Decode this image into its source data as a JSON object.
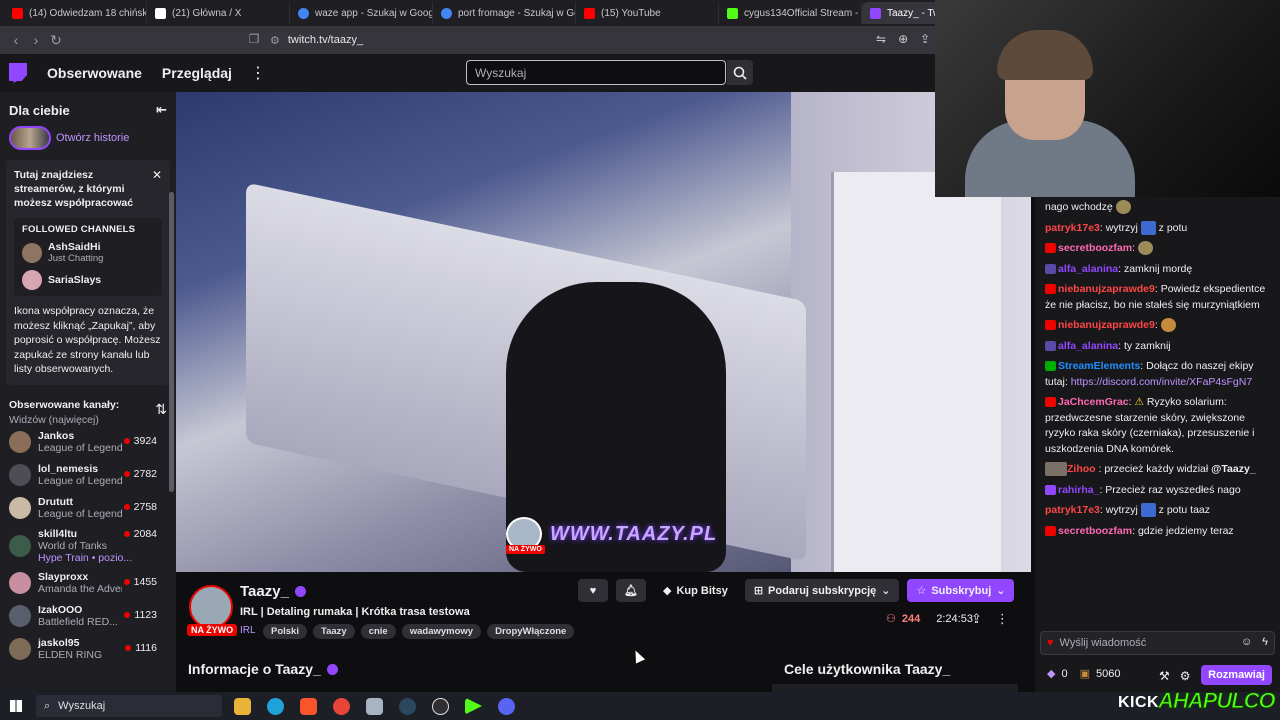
{
  "browser": {
    "tabs": [
      {
        "label": "(14) Odwiedzam 18 chińskich s",
        "color": "#ff0000"
      },
      {
        "label": "(21) Główna / X",
        "color": "#ffffff"
      },
      {
        "label": "waze app - Szukaj w Google",
        "color": "#4285f4"
      },
      {
        "label": "port fromage - Szukaj w Googl",
        "color": "#4285f4"
      },
      {
        "label": "(15) YouTube",
        "color": "#ff0000"
      },
      {
        "label": "cygus134Official Stream - Wat",
        "color": "#53fc18"
      },
      {
        "label": "Taazy_ - Twitch",
        "color": "#9147ff"
      }
    ],
    "url": "twitch.tv/taazy_"
  },
  "topnav": {
    "followed": "Obserwowane",
    "browse": "Przeglądaj",
    "search_placeholder": "Wyszukaj"
  },
  "sidebar": {
    "header": "Dla ciebie",
    "stories_label": "Otwórz historie",
    "collab": {
      "title": "Tutaj znajdziesz streamerów, z którymi możesz współpracować",
      "followed_channels_title": "FOLLOWED CHANNELS",
      "preview_channels": [
        {
          "name": "AshSaidHi",
          "game": "Just Chatting"
        },
        {
          "name": "SariaSlays",
          "game": ""
        }
      ],
      "description": "Ikona współpracy oznacza, że możesz kliknąć „Zapukaj”, aby poprosić o współpracę. Możesz zapukać ze strony kanału lub listy obserwowanych."
    },
    "followed_title": "Obserwowane kanały:",
    "followed_sort": "Widzów (najwięcej)",
    "channels": [
      {
        "name": "Jankos",
        "game": "League of Legends",
        "viewers": "3924",
        "color": "#8a6e5a"
      },
      {
        "name": "lol_nemesis",
        "game": "League of Legends",
        "viewers": "2782",
        "color": "#4d4d55"
      },
      {
        "name": "Drututt",
        "game": "League of Legends",
        "viewers": "2758",
        "color": "#c9b9a6"
      },
      {
        "name": "skill4ltu",
        "game": "World of Tanks",
        "viewers": "2084",
        "extra": "Hype Train • pozio...",
        "color": "#3c5c4a"
      },
      {
        "name": "Slayproxx",
        "game": "Amanda the Adventurer",
        "viewers": "1455",
        "color": "#c88fa0"
      },
      {
        "name": "IzakOOO",
        "game": "Battlefield RED...",
        "viewers": "1123",
        "color": "#5a5f6e"
      },
      {
        "name": "jaskol95",
        "game": "ELDEN RING",
        "viewers": "1116",
        "color": "#7d6b58"
      }
    ]
  },
  "video": {
    "watermark": "WWW.TAAZY.PL",
    "watermark_live": "NA ŻYWO"
  },
  "stream": {
    "channel": "Taazy_",
    "title": "IRL | Detaling rumaka | Krótka trasa testowa",
    "live_badge": "NA ŻYWO",
    "category": "IRL",
    "tags": [
      "Polski",
      "Taazy",
      "cnie",
      "wadawymowy",
      "DropyWłączone"
    ],
    "buy_bits": "Kup Bitsy",
    "gift_sub": "Podaruj subskrypcję",
    "subscribe": "Subskrybuj",
    "viewers": "244",
    "uptime": "2:24:53",
    "about": "Informacje o Taazy_",
    "goals": "Cele użytkownika Taazy_"
  },
  "chat": {
    "messages": [
      {
        "user": "",
        "color": "#efeff1",
        "text": "nago wchodzę",
        "emote": "#9a8b57"
      },
      {
        "user": "patryk17e3",
        "color": "#ff4545",
        "text": "wytrzyj",
        "text2": "z potu",
        "emote_mid": "#3c6ad0"
      },
      {
        "user": "secretboozfam",
        "color": "#ff69b4",
        "text": "",
        "emote": "#9a8b57",
        "badge": "#eb0400"
      },
      {
        "user": "alfa_alanina",
        "color": "#9147ff",
        "text": "zamknij mordę",
        "badge": "#5a4aa8"
      },
      {
        "user": "niebanujzaprawde9",
        "color": "#ff4545",
        "text": "Powiedz ekspedientce że nie płacisz, bo nie stałeś się murzyniątkiem",
        "badge": "#eb0400"
      },
      {
        "user": "niebanujzaprawde9",
        "color": "#ff4545",
        "text": "",
        "emote": "#c58a3e",
        "badge": "#eb0400"
      },
      {
        "user": "alfa_alanina",
        "color": "#9147ff",
        "text": "ty zamknij",
        "badge": "#5a4aa8"
      },
      {
        "user": "StreamElements",
        "color": "#1e90ff",
        "text": "Dołącz do naszej ekipy tutaj:",
        "link": "https://discord.com/invite/XFaP4sFgN7",
        "badge": "#00ad03"
      },
      {
        "user": "JaChcemGrac",
        "color": "#ff69b4",
        "text": "Ryzyko solarium: przedwczesne starzenie skóry, zwiększone ryzyko raka skóry (czerniaka), przesuszenie i uszkodzenia DNA komórek.",
        "badge": "#eb0400"
      },
      {
        "user": "Zihoo",
        "color": "#ff4545",
        "text": ": przecież każdy widział",
        "mention": "@Taazy_"
      },
      {
        "user": "rahirha_",
        "color": "#9147ff",
        "text": "Przecież raz wyszedłeś nago",
        "badge": "#9147ff"
      },
      {
        "user": "patryk17e3",
        "color": "#ff4545",
        "text": "wytrzyj",
        "text2": "z potu taaz",
        "emote_mid": "#3c6ad0"
      },
      {
        "user": "secretboozfam",
        "color": "#ff69b4",
        "text": "gdzie jedziemy teraz",
        "badge": "#eb0400"
      }
    ],
    "input_placeholder": "Wyślij wiadomość",
    "bits": "0",
    "points": "5060",
    "send": "Rozmawiaj"
  },
  "taskbar": {
    "search": "Wyszukaj",
    "kick": "KICK",
    "overlay_text": "AHAPULCO"
  }
}
